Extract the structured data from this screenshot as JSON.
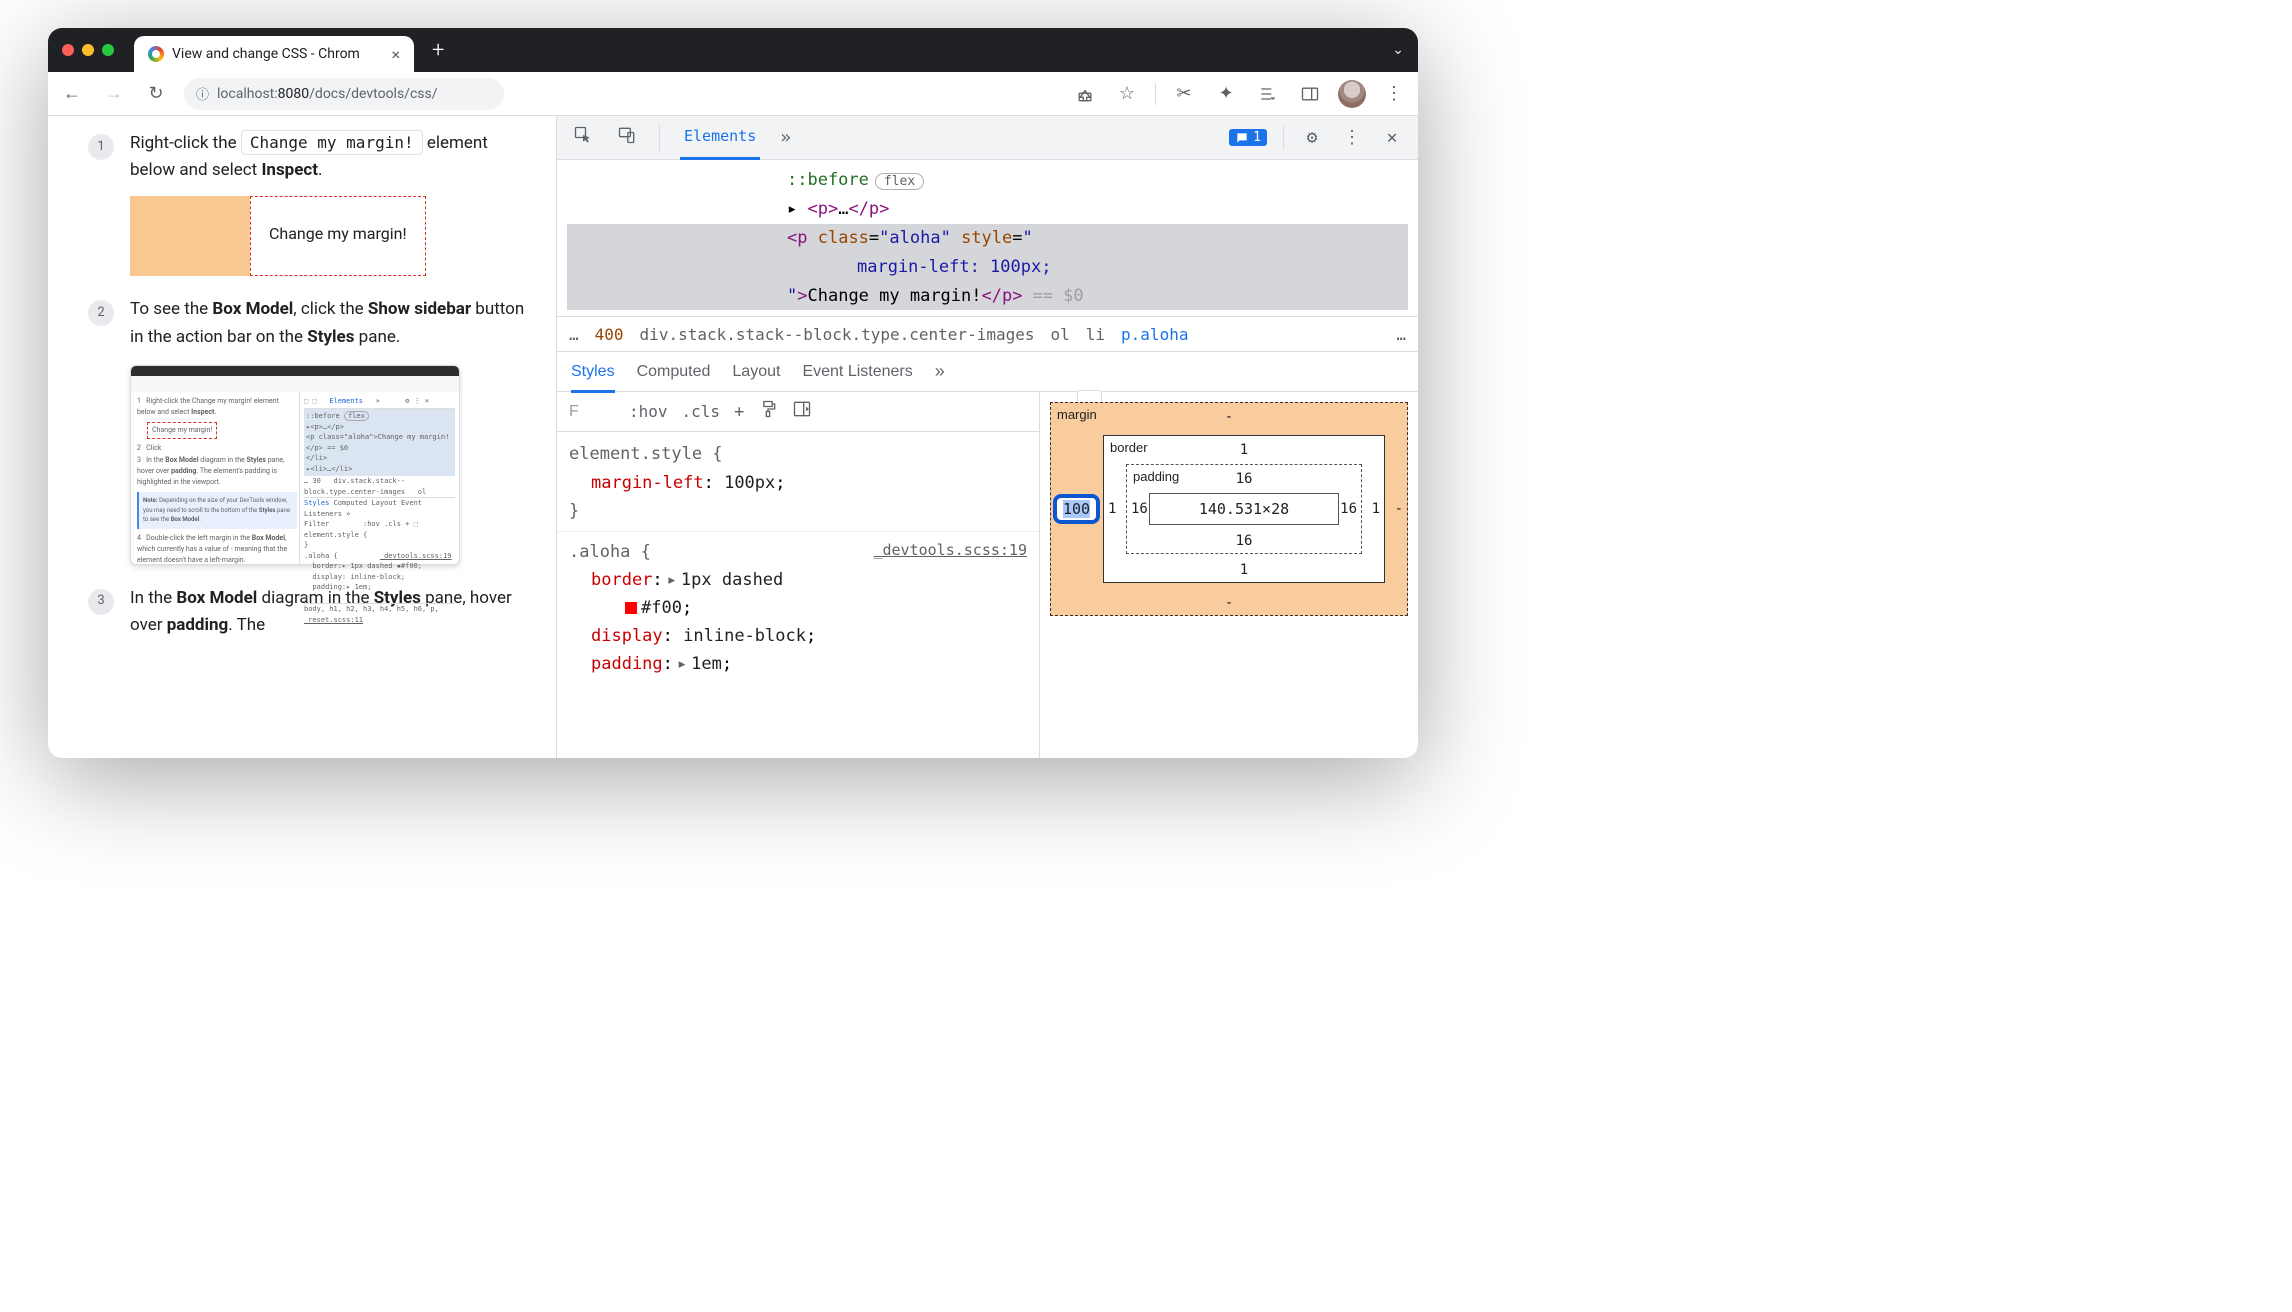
{
  "window": {
    "tab_title": "View and change CSS - Chrom",
    "url_prefix": "localhost:",
    "url_host": "8080",
    "url_path": "/docs/devtools/css/"
  },
  "docs": {
    "step1_a": "Right-click the ",
    "step1_code": "Change my margin!",
    "step1_b": " element below and select ",
    "step1_bold": "Inspect",
    "step1_c": ".",
    "demo_text": "Change my margin!",
    "step2_a": "To see the ",
    "step2_b1": "Box Model",
    "step2_c": ", click the ",
    "step2_b2": "Show sidebar",
    "step2_d": " button in the action bar on the ",
    "step2_b3": "Styles",
    "step2_e": " pane.",
    "step3_a": "In the ",
    "step3_b1": "Box Model",
    "step3_b": " diagram in the ",
    "step3_b2": "Styles",
    "step3_c": " pane, hover over ",
    "step3_b3": "padding",
    "step3_d": ". The"
  },
  "devtools": {
    "tabs": {
      "elements": "Elements"
    },
    "issue_count": "1",
    "dom": {
      "before": "::before",
      "flex_badge": "flex",
      "p_collapsed": "<p>…</p>",
      "sel_open": "<p class=\"aloha\" style=\"",
      "sel_style": "margin-left: 100px;",
      "sel_close": "\">Change my margin!</p>",
      "sel_eq": "== $0"
    },
    "breadcrumb": {
      "dots": "…",
      "num": "400",
      "long": "div.stack.stack--block.type.center-images",
      "ol": "ol",
      "li": "li",
      "active": "p.aloha",
      "more": "…"
    },
    "styles_tabs": {
      "styles": "Styles",
      "computed": "Computed",
      "layout": "Layout",
      "listeners": "Event Listeners"
    },
    "styles_bar": {
      "filter": "F",
      "hov": ":hov",
      "cls": ".cls"
    },
    "rules": {
      "element_style_sel": "element.style {",
      "ml_prop": "margin-left",
      "ml_val": "100px",
      "close_brace": "}",
      "aloha_sel": ".aloha {",
      "aloha_link": "_devtools.scss:19",
      "border_prop": "border",
      "border_val": "1px dashed",
      "border_color": "#f00",
      "display_prop": "display",
      "display_val": "inline-block",
      "padding_prop": "padding",
      "padding_val": "1em"
    },
    "box_model": {
      "margin_label": "margin",
      "border_label": "border",
      "padding_label": "padding",
      "margin_t": "-",
      "margin_r": "-",
      "margin_b": "-",
      "margin_l": "100",
      "border_t": "1",
      "border_r": "1",
      "border_b": "1",
      "border_l": "1",
      "pad_t": "16",
      "pad_r": "16",
      "pad_b": "16",
      "pad_l": "16",
      "content": "140.531×28"
    }
  }
}
